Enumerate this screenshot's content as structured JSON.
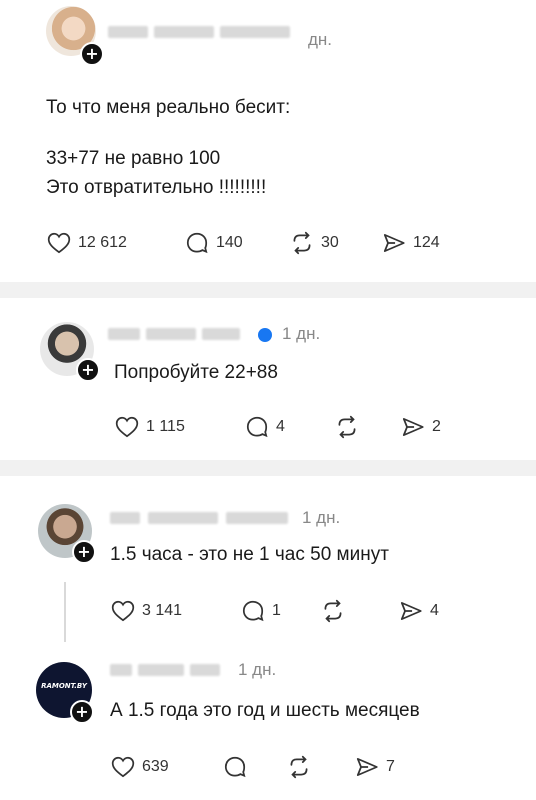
{
  "posts": [
    {
      "time": "дн.",
      "lines": [
        "То что меня реально бесит:",
        "33+77 не равно 100",
        "Это отвратительно !!!!!!!!!"
      ],
      "likes": "12 612",
      "replies": "140",
      "reposts": "30",
      "shares": "124"
    },
    {
      "time": "1 дн.",
      "lines": [
        "Попробуйте 22+88"
      ],
      "likes": "1 115",
      "replies": "4",
      "reposts": "",
      "shares": "2"
    },
    {
      "time": "1 дн.",
      "lines": [
        "1.5 часа - это не 1 час 50 минут"
      ],
      "likes": "3 141",
      "replies": "1",
      "reposts": "",
      "shares": "4"
    },
    {
      "time": "1 дн.",
      "avatar_text": "RAMONT.BY",
      "lines": [
        "А 1.5 года это год и шесть месяцев"
      ],
      "likes": "639",
      "replies": "",
      "reposts": "",
      "shares": "7"
    }
  ],
  "icons": {
    "like": "heart-icon",
    "reply": "comment-icon",
    "repost": "repost-icon",
    "share": "share-icon",
    "follow": "plus-icon"
  },
  "colors": {
    "verified": "#1877f2",
    "divider": "#f1f1f1",
    "meta": "#888888"
  }
}
